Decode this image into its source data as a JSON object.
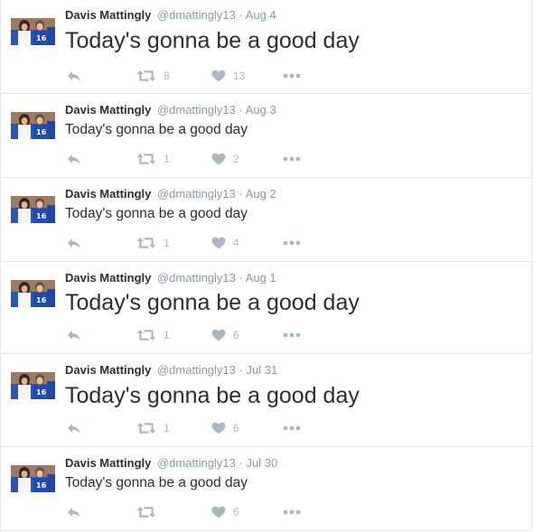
{
  "colors": {
    "name": "#292f33",
    "meta": "#8899a6",
    "action": "#aab8c2",
    "border": "#e1e8ed"
  },
  "tweets": [
    {
      "name": "Davis Mattingly",
      "handle": "@dmattingly13",
      "sep": "·",
      "date": "Aug 4",
      "text": "Today's gonna be a good day",
      "retweets": "8",
      "likes": "13"
    },
    {
      "name": "Davis Mattingly",
      "handle": "@dmattingly13",
      "sep": "·",
      "date": "Aug 3",
      "text": "Today's gonna be a good day",
      "retweets": "1",
      "likes": "2"
    },
    {
      "name": "Davis Mattingly",
      "handle": "@dmattingly13",
      "sep": "·",
      "date": "Aug 2",
      "text": "Today's gonna be a good day",
      "retweets": "1",
      "likes": "4"
    },
    {
      "name": "Davis Mattingly",
      "handle": "@dmattingly13",
      "sep": "·",
      "date": "Aug 1",
      "text": "Today's gonna be a good day",
      "retweets": "1",
      "likes": "6"
    },
    {
      "name": "Davis Mattingly",
      "handle": "@dmattingly13",
      "sep": "·",
      "date": "Jul 31",
      "text": "Today's gonna be a good day",
      "retweets": "1",
      "likes": "6"
    },
    {
      "name": "Davis Mattingly",
      "handle": "@dmattingly13",
      "sep": "·",
      "date": "Jul 30",
      "text": "Today's gonna be a good day",
      "retweets": "",
      "likes": "6"
    }
  ]
}
